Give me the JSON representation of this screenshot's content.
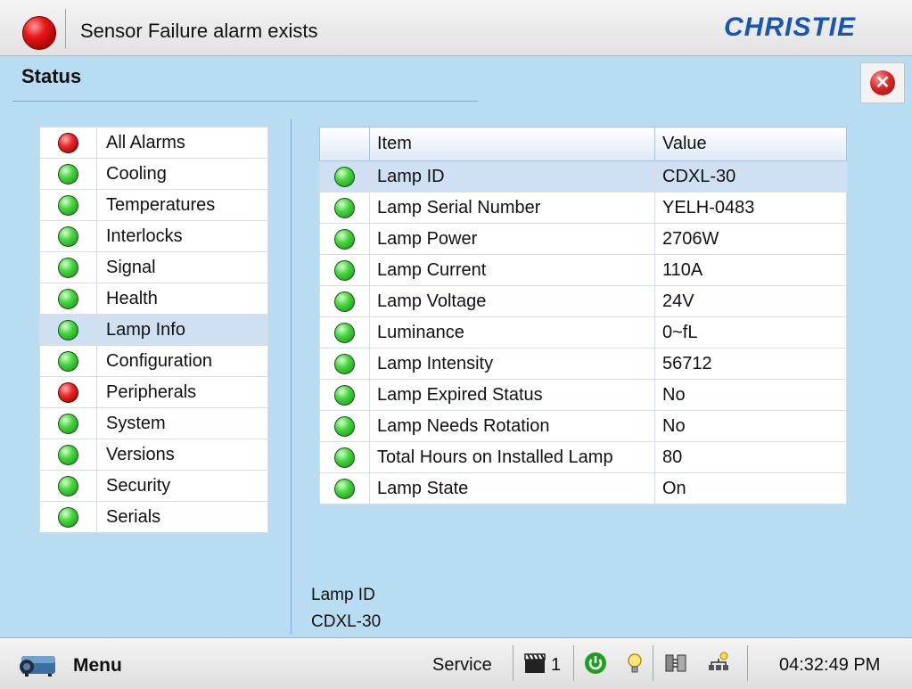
{
  "header": {
    "alarm_text": "Sensor Failure alarm exists",
    "alarm_status_color": "#e81818",
    "logo_text": "CHRISTIE"
  },
  "page": {
    "title": "Status"
  },
  "categories": [
    {
      "label": "All Alarms",
      "status": "red"
    },
    {
      "label": "Cooling",
      "status": "green"
    },
    {
      "label": "Temperatures",
      "status": "green"
    },
    {
      "label": "Interlocks",
      "status": "green"
    },
    {
      "label": "Signal",
      "status": "green"
    },
    {
      "label": "Health",
      "status": "green"
    },
    {
      "label": "Lamp Info",
      "status": "green",
      "selected": true
    },
    {
      "label": "Configuration",
      "status": "green"
    },
    {
      "label": "Peripherals",
      "status": "red"
    },
    {
      "label": "System",
      "status": "green"
    },
    {
      "label": "Versions",
      "status": "green"
    },
    {
      "label": "Security",
      "status": "green"
    },
    {
      "label": "Serials",
      "status": "green"
    }
  ],
  "table": {
    "headers": {
      "item": "Item",
      "value": "Value"
    },
    "rows": [
      {
        "item": "Lamp ID",
        "value": "CDXL-30",
        "status": "green",
        "selected": true
      },
      {
        "item": "Lamp Serial Number",
        "value": "YELH-0483",
        "status": "green"
      },
      {
        "item": "Lamp Power",
        "value": "2706W",
        "status": "green"
      },
      {
        "item": "Lamp Current",
        "value": "110A",
        "status": "green"
      },
      {
        "item": "Lamp Voltage",
        "value": "24V",
        "status": "green"
      },
      {
        "item": "Luminance",
        "value": "0~fL",
        "status": "green"
      },
      {
        "item": "Lamp Intensity",
        "value": "56712",
        "status": "green"
      },
      {
        "item": "Lamp Expired Status",
        "value": "No",
        "status": "green"
      },
      {
        "item": "Lamp Needs Rotation",
        "value": "No",
        "status": "green"
      },
      {
        "item": "Total Hours on Installed Lamp",
        "value": "80",
        "status": "green"
      },
      {
        "item": "Lamp State",
        "value": "On",
        "status": "green"
      }
    ]
  },
  "detail": {
    "label": "Lamp ID",
    "value": "CDXL-30"
  },
  "footer": {
    "menu_label": "Menu",
    "service_label": "Service",
    "channel_number": "1",
    "clock": "04:32:49 PM"
  },
  "colors": {
    "status_green": "#48d640",
    "status_red": "#ea2a2a",
    "background": "#b8dcf2"
  }
}
